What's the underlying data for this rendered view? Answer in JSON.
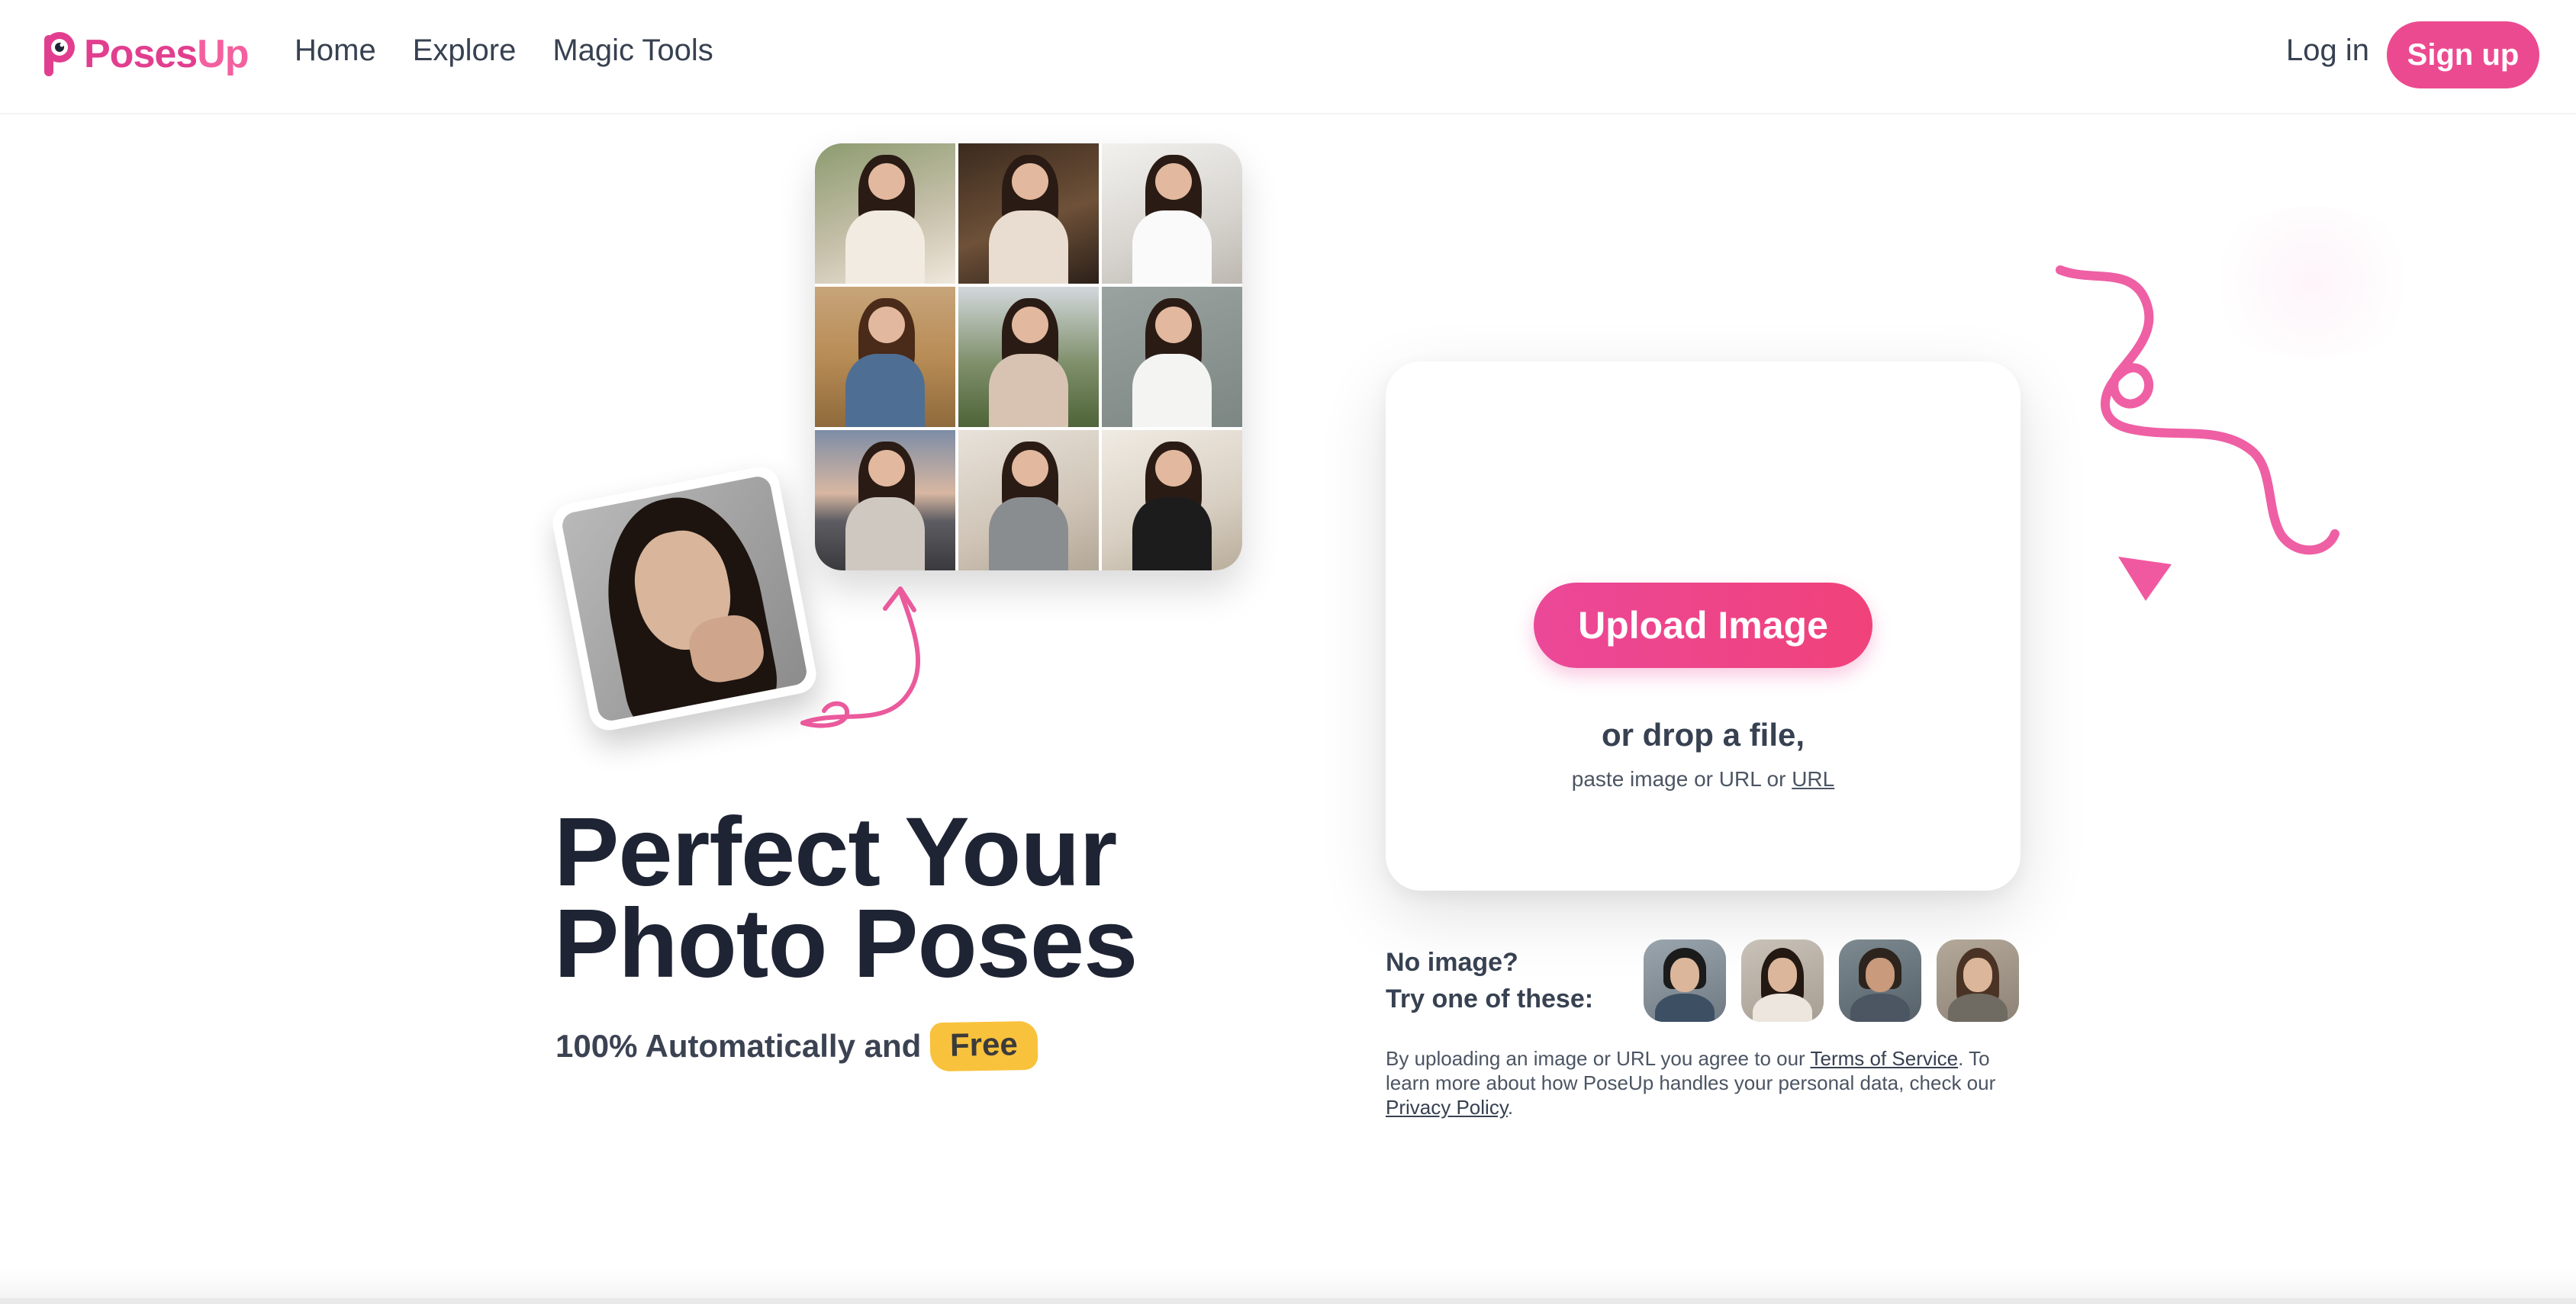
{
  "brand": {
    "name_part1": "Poses",
    "name_part2": "Up",
    "color_primary": "#e23e8f",
    "color_secondary": "#f4609f"
  },
  "nav": {
    "items": [
      {
        "label": "Home"
      },
      {
        "label": "Explore"
      },
      {
        "label": "Magic Tools"
      }
    ],
    "login_label": "Log in",
    "signup_label": "Sign up"
  },
  "hero": {
    "headline_line1": "Perfect Your",
    "headline_line2": "Photo Poses",
    "subline": "100% Automatically and",
    "badge": "Free",
    "badge_color": "#f9c23c"
  },
  "upload": {
    "button_label": "Upload Image",
    "drop_text": "or drop a file,",
    "paste_text": "paste image or URL or",
    "url_link": "URL",
    "accent": "#ec4899"
  },
  "samples": {
    "line1": "No image?",
    "line2": "Try one of these:",
    "thumbnails": [
      {
        "icon": "sample-man-photo"
      },
      {
        "icon": "sample-woman-photo"
      },
      {
        "icon": "sample-man-beard-photo"
      },
      {
        "icon": "sample-woman-smile-photo"
      }
    ]
  },
  "terms": {
    "prefix": "By uploading an image or URL you agree to our",
    "tos_link": "Terms of Service",
    "middle": ". To learn more about how PoseUp handles your personal data, check our",
    "privacy_link": "Privacy Policy",
    "suffix": "."
  },
  "gallery": {
    "tiles": [
      "selfie-with-coffee-photo",
      "cafe-laughing-photo",
      "bedroom-portrait-photo",
      "field-denim-jacket-photo",
      "park-sitting-photo",
      "chin-on-hand-photo",
      "pier-sunset-photo",
      "kitchen-mirror-selfie-photo",
      "gallery-standing-photo"
    ],
    "source_portrait": "source-portrait-photo"
  },
  "decorations": {
    "squiggle": "squiggle-icon",
    "triangle": "triangle-icon",
    "arrow": "curly-arrow-icon"
  }
}
